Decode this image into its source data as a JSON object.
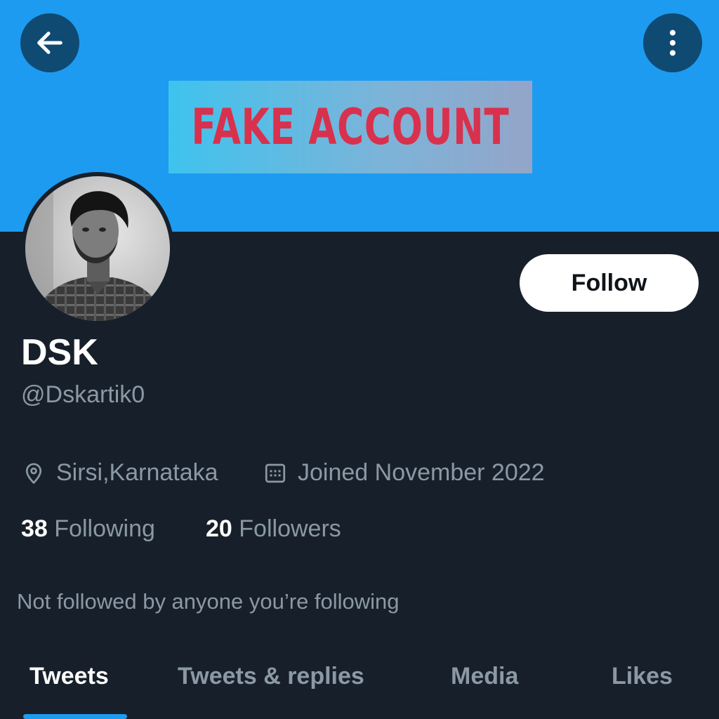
{
  "header": {
    "back_icon": "arrow-left-icon",
    "more_icon": "more-vertical-icon",
    "stamp_text": "FAKE ACCOUNT"
  },
  "profile": {
    "name": "DSK",
    "handle": "@Dskartik0",
    "follow_label": "Follow",
    "location": "Sirsi,Karnataka",
    "joined": "Joined November 2022",
    "following_count": "38",
    "following_label": "Following",
    "followers_count": "20",
    "followers_label": "Followers",
    "not_followed_note": "Not followed by anyone you’re following"
  },
  "tabs": [
    {
      "label": "Tweets",
      "active": true
    },
    {
      "label": "Tweets & replies",
      "active": false
    },
    {
      "label": "Media",
      "active": false
    },
    {
      "label": "Likes",
      "active": false
    }
  ],
  "colors": {
    "banner": "#1d9bf0",
    "background": "#17202a",
    "accent": "#1d9bf0",
    "stamp_text": "#d8314d",
    "secondary_text": "#8b98a5"
  }
}
